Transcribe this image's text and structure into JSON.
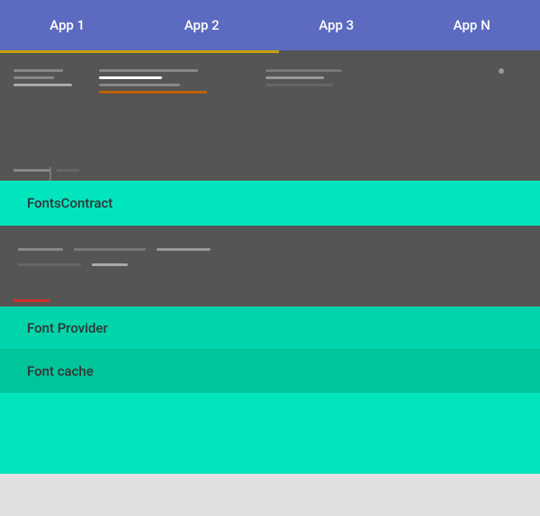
{
  "appBar": {
    "tabs": [
      {
        "label": "App 1"
      },
      {
        "label": "App 2"
      },
      {
        "label": "App 3"
      },
      {
        "label": "App N"
      }
    ]
  },
  "sections": {
    "fontsContract": {
      "label": "FontsContract"
    },
    "fontProvider": {
      "label": "Font Provider"
    },
    "fontCache": {
      "label": "Font cache"
    }
  },
  "colors": {
    "appBar": "#5c6bc0",
    "darkSection": "#555555",
    "teal1": "#00e5be",
    "teal2": "#00d4aa",
    "teal3": "#00c49a",
    "teal4": "#00e5be"
  }
}
